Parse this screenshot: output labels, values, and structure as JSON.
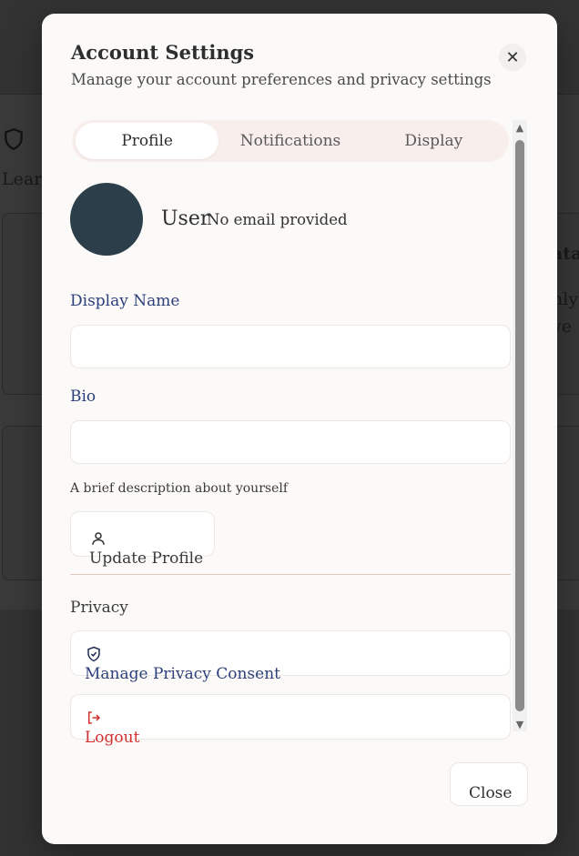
{
  "background": {
    "subtitle_fragment": "Learn",
    "side_text": [
      "ata",
      "nly",
      "ve"
    ]
  },
  "modal": {
    "title": "Account Settings",
    "description": "Manage your account preferences and privacy settings",
    "close_icon": "close-icon"
  },
  "tabs": [
    {
      "label": "Profile",
      "active": true
    },
    {
      "label": "Notifications",
      "active": false
    },
    {
      "label": "Display",
      "active": false
    }
  ],
  "profile": {
    "name": "User",
    "email": "No email provided",
    "display_name_label": "Display Name",
    "display_name_value": "",
    "bio_label": "Bio",
    "bio_value": "",
    "bio_hint": "A brief description about yourself",
    "update_button": "Update Profile",
    "update_icon": "user-icon"
  },
  "privacy": {
    "section_label": "Privacy",
    "manage_consent_button": "Manage Privacy Consent",
    "manage_consent_icon": "shield-check-icon",
    "logout_button": "Logout",
    "logout_icon": "logout-icon"
  },
  "footer": {
    "close_button": "Close"
  },
  "colors": {
    "accent_blue": "#2c3f7a",
    "danger_red": "#d32f2f",
    "avatar_bg": "#2c3e4a",
    "tabs_bg": "#f8eeec"
  }
}
